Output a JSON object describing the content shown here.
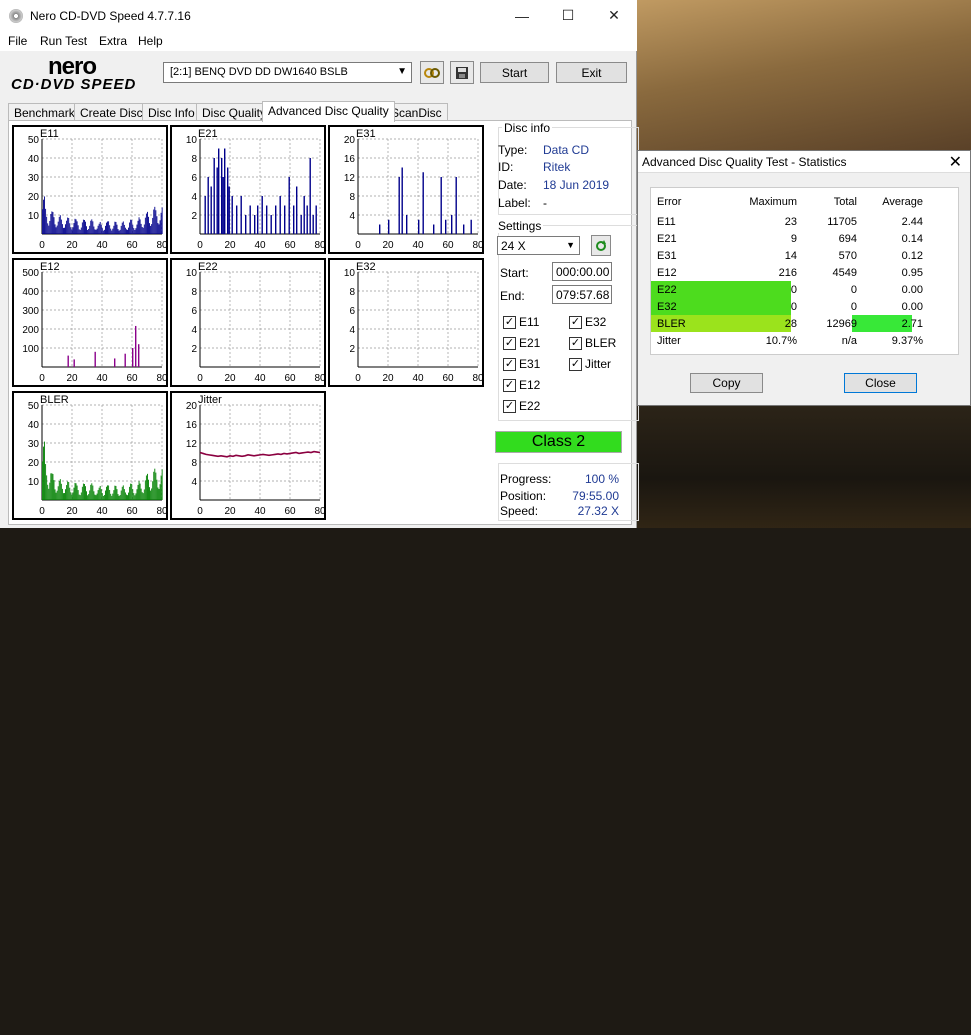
{
  "window": {
    "title": "Nero CD-DVD Speed 4.7.7.16"
  },
  "menu": [
    "File",
    "Run Test",
    "Extra",
    "Help"
  ],
  "logo": {
    "top": "nero",
    "bottom": "CD·DVD SPEED"
  },
  "drive": {
    "selected": "[2:1]   BENQ DVD DD DW1640 BSLB"
  },
  "buttons": {
    "start": "Start",
    "exit": "Exit"
  },
  "tabs": [
    "Benchmark",
    "Create Disc",
    "Disc Info",
    "Disc Quality",
    "Advanced Disc Quality",
    "ScanDisc"
  ],
  "active_tab": "Advanced Disc Quality",
  "disc_info": {
    "header": "Disc info",
    "type_label": "Type:",
    "type": "Data CD",
    "id_label": "ID:",
    "id": "Ritek",
    "date_label": "Date:",
    "date": "18 Jun 2019",
    "label_label": "Label:",
    "label": "-"
  },
  "settings": {
    "header": "Settings",
    "speed": "24 X",
    "start_label": "Start:",
    "start": "000:00.00",
    "end_label": "End:",
    "end": "079:57.68",
    "checks": [
      {
        "label": "E11",
        "checked": true
      },
      {
        "label": "E32",
        "checked": true
      },
      {
        "label": "E21",
        "checked": true
      },
      {
        "label": "BLER",
        "checked": true
      },
      {
        "label": "E31",
        "checked": true
      },
      {
        "label": "Jitter",
        "checked": true
      },
      {
        "label": "E12",
        "checked": true
      },
      {
        "label": "E22",
        "checked": true
      }
    ]
  },
  "class_result": "Class 2",
  "progress": {
    "progress_label": "Progress:",
    "progress": "100 %",
    "position_label": "Position:",
    "position": "79:55.00",
    "speed_label": "Speed:",
    "speed": "27.32 X"
  },
  "stats": {
    "title": "Advanced Disc Quality Test - Statistics",
    "headers": [
      "Error",
      "Maximum",
      "Total",
      "Average"
    ],
    "rows": [
      {
        "error": "E11",
        "maximum": "23",
        "total": "11705",
        "average": "2.44"
      },
      {
        "error": "E21",
        "maximum": "9",
        "total": "694",
        "average": "0.14"
      },
      {
        "error": "E31",
        "maximum": "14",
        "total": "570",
        "average": "0.12"
      },
      {
        "error": "E12",
        "maximum": "216",
        "total": "4549",
        "average": "0.95"
      },
      {
        "error": "E22",
        "maximum": "0",
        "total": "0",
        "average": "0.00"
      },
      {
        "error": "E32",
        "maximum": "0",
        "total": "0",
        "average": "0.00"
      },
      {
        "error": "BLER",
        "maximum": "28",
        "total": "12969",
        "average": "2.71"
      },
      {
        "error": "Jitter",
        "maximum": "10.7%",
        "total": "n/a",
        "average": "9.37%"
      }
    ],
    "copy": "Copy",
    "close": "Close"
  },
  "chart_data": [
    {
      "type": "bar",
      "title": "E11",
      "ylim": [
        0,
        50
      ],
      "yticks": [
        "50",
        "40",
        "30",
        "20",
        "10"
      ],
      "xticks": [
        "0",
        "20",
        "40",
        "60",
        "80"
      ],
      "color": "#00008b",
      "profile": [
        18,
        14,
        12,
        11,
        10,
        9,
        8,
        9,
        8,
        7,
        8,
        7,
        6,
        7,
        8,
        6,
        7,
        6,
        5,
        6,
        5,
        6,
        7,
        5,
        6,
        5,
        6,
        5,
        6,
        7,
        6,
        7,
        8,
        9,
        10,
        11,
        12,
        13,
        14,
        13,
        12
      ]
    },
    {
      "type": "bar",
      "title": "E21",
      "ylim": [
        0,
        10
      ],
      "yticks": [
        "10",
        "8",
        "6",
        "4",
        "2"
      ],
      "xticks": [
        "0",
        "20",
        "40",
        "60",
        "80"
      ],
      "color": "#00008b",
      "spikes": [
        [
          3,
          4
        ],
        [
          5,
          6
        ],
        [
          7,
          5
        ],
        [
          9,
          8
        ],
        [
          11,
          7
        ],
        [
          12,
          9
        ],
        [
          14,
          8
        ],
        [
          15,
          6
        ],
        [
          16,
          9
        ],
        [
          18,
          7
        ],
        [
          19,
          5
        ],
        [
          21,
          4
        ],
        [
          24,
          3
        ],
        [
          27,
          4
        ],
        [
          30,
          2
        ],
        [
          33,
          3
        ],
        [
          36,
          2
        ],
        [
          38,
          3
        ],
        [
          41,
          4
        ],
        [
          44,
          3
        ],
        [
          47,
          2
        ],
        [
          50,
          3
        ],
        [
          53,
          4
        ],
        [
          56,
          3
        ],
        [
          59,
          6
        ],
        [
          62,
          3
        ],
        [
          64,
          5
        ],
        [
          67,
          2
        ],
        [
          69,
          4
        ],
        [
          71,
          3
        ],
        [
          73,
          8
        ],
        [
          75,
          2
        ],
        [
          77,
          3
        ]
      ]
    },
    {
      "type": "bar",
      "title": "E31",
      "ylim": [
        0,
        20
      ],
      "yticks": [
        "20",
        "16",
        "12",
        "8",
        "4"
      ],
      "xticks": [
        "0",
        "20",
        "40",
        "60",
        "80"
      ],
      "color": "#00008b",
      "spikes": [
        [
          14,
          2
        ],
        [
          20,
          3
        ],
        [
          27,
          12
        ],
        [
          29,
          14
        ],
        [
          32,
          4
        ],
        [
          40,
          3
        ],
        [
          43,
          13
        ],
        [
          50,
          2
        ],
        [
          55,
          12
        ],
        [
          58,
          3
        ],
        [
          62,
          4
        ],
        [
          65,
          12
        ],
        [
          70,
          2
        ],
        [
          75,
          3
        ]
      ]
    },
    {
      "type": "bar",
      "title": "E12",
      "ylim": [
        0,
        500
      ],
      "yticks": [
        "500",
        "400",
        "300",
        "200",
        "100"
      ],
      "xticks": [
        "0",
        "20",
        "40",
        "60",
        "80"
      ],
      "color": "#8b008b",
      "spikes": [
        [
          17,
          60
        ],
        [
          21,
          40
        ],
        [
          35,
          80
        ],
        [
          48,
          45
        ],
        [
          55,
          70
        ],
        [
          60,
          100
        ],
        [
          62,
          216
        ],
        [
          64,
          120
        ]
      ]
    },
    {
      "type": "bar",
      "title": "E22",
      "ylim": [
        0,
        10
      ],
      "yticks": [
        "10",
        "8",
        "6",
        "4",
        "2"
      ],
      "xticks": [
        "0",
        "20",
        "40",
        "60",
        "80"
      ],
      "color": "#00008b",
      "spikes": []
    },
    {
      "type": "bar",
      "title": "E32",
      "ylim": [
        0,
        10
      ],
      "yticks": [
        "10",
        "8",
        "6",
        "4",
        "2"
      ],
      "xticks": [
        "0",
        "20",
        "40",
        "60",
        "80"
      ],
      "color": "#00008b",
      "spikes": []
    },
    {
      "type": "bar",
      "title": "BLER",
      "ylim": [
        0,
        50
      ],
      "yticks": [
        "50",
        "40",
        "30",
        "20",
        "10"
      ],
      "xticks": [
        "0",
        "20",
        "40",
        "60",
        "80"
      ],
      "color": "#008000",
      "profile": [
        28,
        20,
        16,
        13,
        11,
        10,
        9,
        10,
        9,
        8,
        9,
        8,
        7,
        8,
        9,
        7,
        8,
        7,
        6,
        7,
        6,
        7,
        8,
        6,
        7,
        6,
        7,
        6,
        7,
        8,
        7,
        8,
        9,
        10,
        12,
        13,
        14,
        15,
        16,
        15,
        14
      ]
    },
    {
      "type": "line",
      "title": "Jitter",
      "ylim": [
        0,
        20
      ],
      "yticks": [
        "20",
        "16",
        "12",
        "8",
        "4"
      ],
      "xticks": [
        "0",
        "20",
        "40",
        "60",
        "80"
      ],
      "color": "#8b0040",
      "values": [
        10,
        9.8,
        9.6,
        9.5,
        9.4,
        9.3,
        9.2,
        9.3,
        9.2,
        9.1,
        9.3,
        9.2,
        9.4,
        9.3,
        9.2,
        9.3,
        9.5,
        9.4,
        9.3,
        9.4,
        9.5,
        9.6,
        9.5,
        9.4,
        9.5,
        9.6,
        9.7,
        9.6,
        9.8,
        9.7,
        9.8,
        9.9,
        10,
        9.8,
        9.9,
        10,
        10.1,
        10,
        10.2,
        10.1,
        10
      ]
    }
  ]
}
